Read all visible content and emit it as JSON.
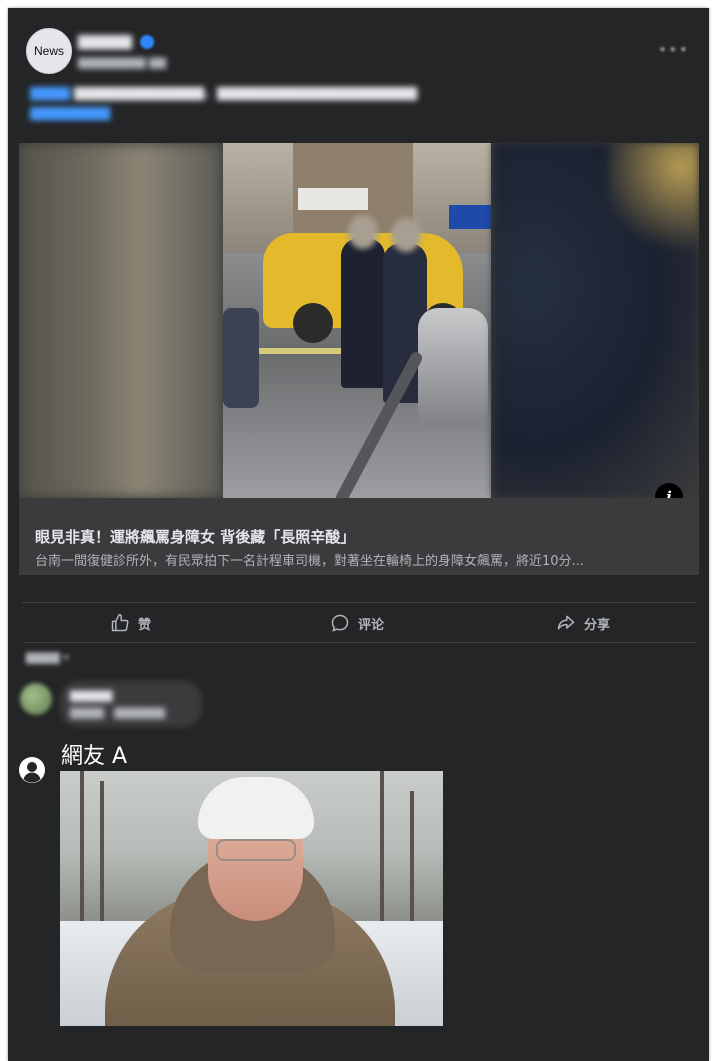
{
  "post": {
    "avatar_label": "News",
    "link_title": "眼見非真！運將飆罵身障女 背後藏「長照辛酸」",
    "link_description": "台南一間復健診所外，有民眾拍下一名計程車司機，對著坐在輪椅上的身障女飆罵，將近10分...",
    "info_icon_glyph": "i"
  },
  "actions": [
    {
      "label": "赞",
      "icon": "thumbs-up-icon"
    },
    {
      "label": "评论",
      "icon": "comment-bubble-icon"
    },
    {
      "label": "分享",
      "icon": "share-arrow-icon"
    }
  ],
  "overlay_comment": {
    "name": "網友 A",
    "icon": "user-silhouette-icon",
    "image": "meme-photo"
  },
  "colors": {
    "card_bg": "#242526",
    "link_box_bg": "#3a3b3c",
    "text_primary": "#e4e6eb",
    "text_secondary": "#b0b3b8"
  }
}
